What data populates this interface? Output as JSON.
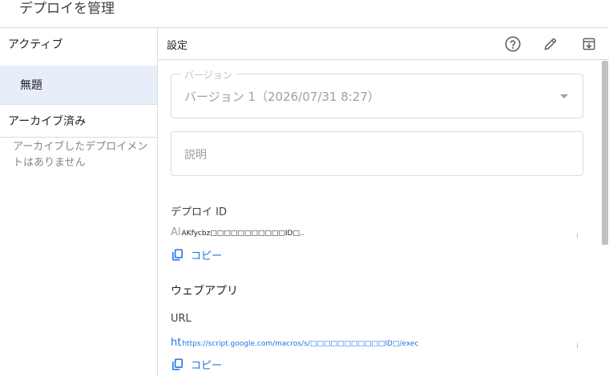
{
  "dialog": {
    "title": "デプロイを管理"
  },
  "left": {
    "active_heading": "アクティブ",
    "active_items": [
      {
        "label": "無題",
        "selected": true
      }
    ],
    "archived_heading": "アーカイブ済み",
    "archived_empty": "アーカイブしたデプロイメントはありません"
  },
  "right": {
    "header_label": "設定",
    "icons": {
      "help": "help-circle-icon",
      "edit": "pencil-icon",
      "archive": "archive-icon"
    },
    "version_field": {
      "label": "バージョン",
      "value": "バージョン 1（2026/07/31 8:27）"
    },
    "description_field": {
      "placeholder": "説明"
    },
    "deploy_id": {
      "label": "デプロイ ID",
      "ghost_prefix": "Al",
      "value": "AKfycbz□□□□□□□□□□□ID□..",
      "copy_label": "コピー"
    },
    "web_app": {
      "section_label": "ウェブアプリ",
      "url_label": "URL",
      "url_ghost_prefix": "ht",
      "url_value": "https://script.google.com/macros/s/□□□□□□□□□□□ID□/exec",
      "copy_label": "コピー"
    }
  },
  "colors": {
    "accent": "#1a73e8",
    "selected_bg": "#e8eef9",
    "border": "#dadce0"
  }
}
